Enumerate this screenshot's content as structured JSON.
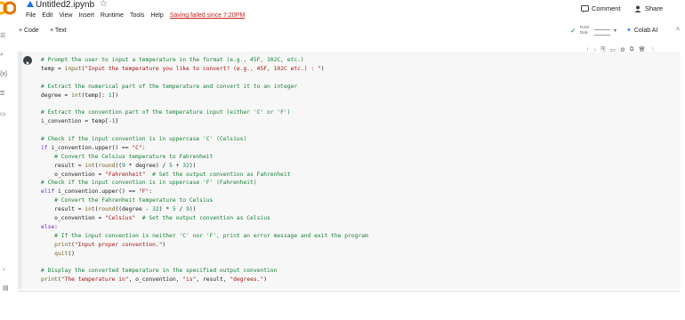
{
  "header": {
    "notebook_title": "Untitled2.ipynb",
    "menu": [
      "File",
      "Edit",
      "View",
      "Insert",
      "Runtime",
      "Tools",
      "Help"
    ],
    "save_status": "Saving failed since 7:20PM",
    "comment_label": "Comment",
    "share_label": "Share"
  },
  "toolbar": {
    "add_code": "+ Code",
    "add_text": "+ Text",
    "ram_label": "RAM",
    "disk_label": "Disk",
    "colab_ai": "Colab AI"
  },
  "icons": {
    "logo": "colab-logo-icon",
    "star": "star-icon",
    "comment": "comment-icon",
    "share": "person-add-icon",
    "run": "play-icon",
    "check": "check-icon",
    "colab_ai": "sparkle-icon"
  },
  "colors": {
    "logo_orange": "#f9ab00",
    "save_failed": "#c5221f",
    "comment_green": "#188038",
    "string_red": "#a31515",
    "keyword_purple": "#7627bb"
  },
  "code": {
    "lines": [
      "# Prompt the user to input a temperature in the format (e.g., 45F, 102C, etc.)",
      "temp = input(\"Input the temperature you like to convert? (e.g., 45F, 102C etc.) : \")",
      "",
      "# Extract the numerical part of the temperature and convert it to an integer",
      "degree = int(temp[: 1])",
      "",
      "# Extract the convention part of the temperature input (either 'C' or 'F')",
      "i_convention = temp[-1]",
      "",
      "# Check if the input convention is in uppercase 'C' (Celsius)",
      "if i_convention.upper() == \"C\":",
      "    # Convert the Celsius temperature to Fahrenheit",
      "    result = int(round((9 * degree) / 5 + 32))",
      "    o_convention = \"Fahrenheit\"  # Set the output convention as Fahrenheit",
      "# Check if the input convention is in uppercase 'F' (Fahrenheit)",
      "elif i_convention.upper() == \"F\":",
      "    # Convert the Fahrenheit temperature to Celsius",
      "    result = int(round((degree - 32) * 5 / 9))",
      "    o_convention = \"Celsius\"  # Set the output convention as Celsius",
      "else:",
      "    # If the input convention is neither 'C' nor 'F', print an error message and exit the program",
      "    print(\"Input proper convention.\")",
      "    quit()",
      "",
      "# Display the converted temperature in the specified output convention",
      "print(\"The temperature in\", o_convention, \"is\", result, \"degrees.\")"
    ]
  }
}
